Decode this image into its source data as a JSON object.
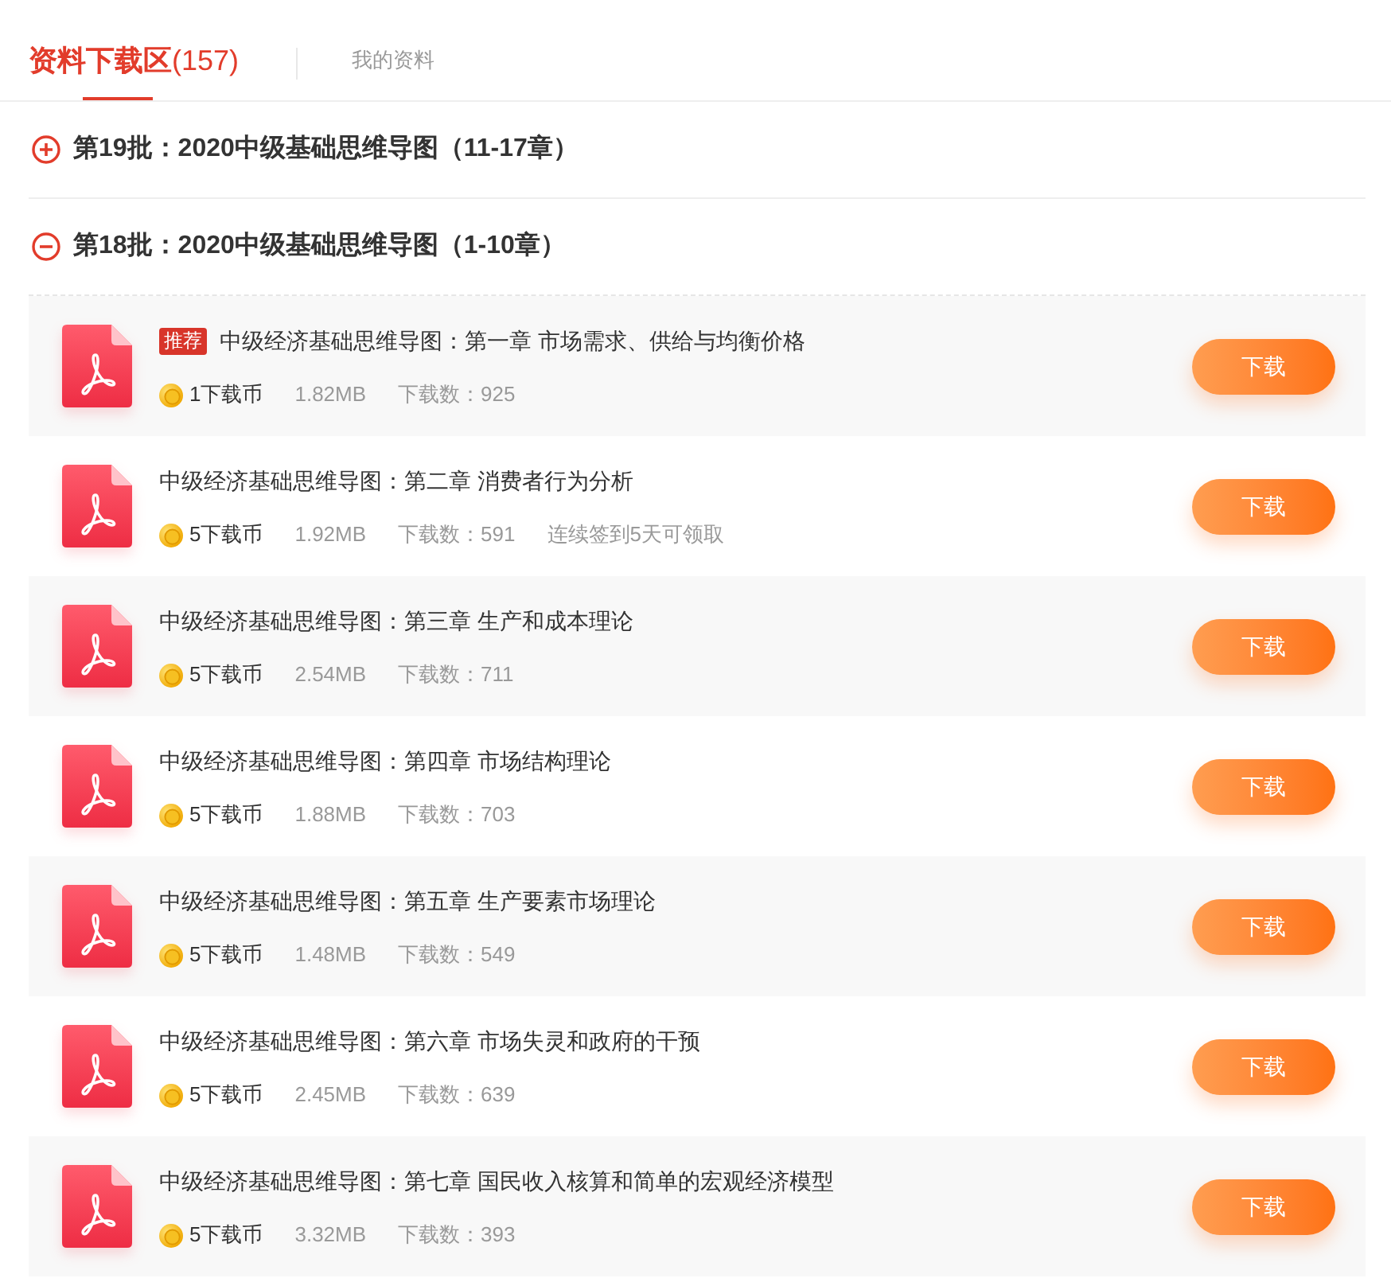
{
  "tabs": [
    {
      "label": "**资料下载区**(157)",
      "selected": true
    },
    {
      "label": "我的资料",
      "selected": false
    }
  ],
  "batches": [
    {
      "title": "第19批：2020中级基础思维导图（11-17章）",
      "expanded": false
    },
    {
      "title": "第18批：2020中级基础思维导图（1-10章）",
      "expanded": true,
      "files": [
        {
          "badge": "推荐",
          "title": "中级经济基础思维导图：第一章 市场需求、供给与均衡价格",
          "price": "1下载币",
          "size": "1.82MB",
          "downloads": "下载数：925",
          "button": "下载"
        },
        {
          "title": "中级经济基础思维导图：第二章 消费者行为分析",
          "price": "5下载币",
          "size": "1.92MB",
          "downloads": "下载数：591",
          "note": "连续签到5天可领取",
          "button": "下载"
        },
        {
          "title": "中级经济基础思维导图：第三章 生产和成本理论",
          "price": "5下载币",
          "size": "2.54MB",
          "downloads": "下载数：711",
          "button": "下载"
        },
        {
          "title": "中级经济基础思维导图：第四章 市场结构理论",
          "price": "5下载币",
          "size": "1.88MB",
          "downloads": "下载数：703",
          "button": "下载"
        },
        {
          "title": "中级经济基础思维导图：第五章 生产要素市场理论",
          "price": "5下载币",
          "size": "1.48MB",
          "downloads": "下载数：549",
          "button": "下载"
        },
        {
          "title": "中级经济基础思维导图：第六章 市场失灵和政府的干预",
          "price": "5下载币",
          "size": "2.45MB",
          "downloads": "下载数：639",
          "button": "下载"
        },
        {
          "title": "中级经济基础思维导图：第七章 国民收入核算和简单的宏观经济模型",
          "price": "5下载币",
          "size": "3.32MB",
          "downloads": "下载数：393",
          "button": "下载"
        }
      ]
    }
  ]
}
